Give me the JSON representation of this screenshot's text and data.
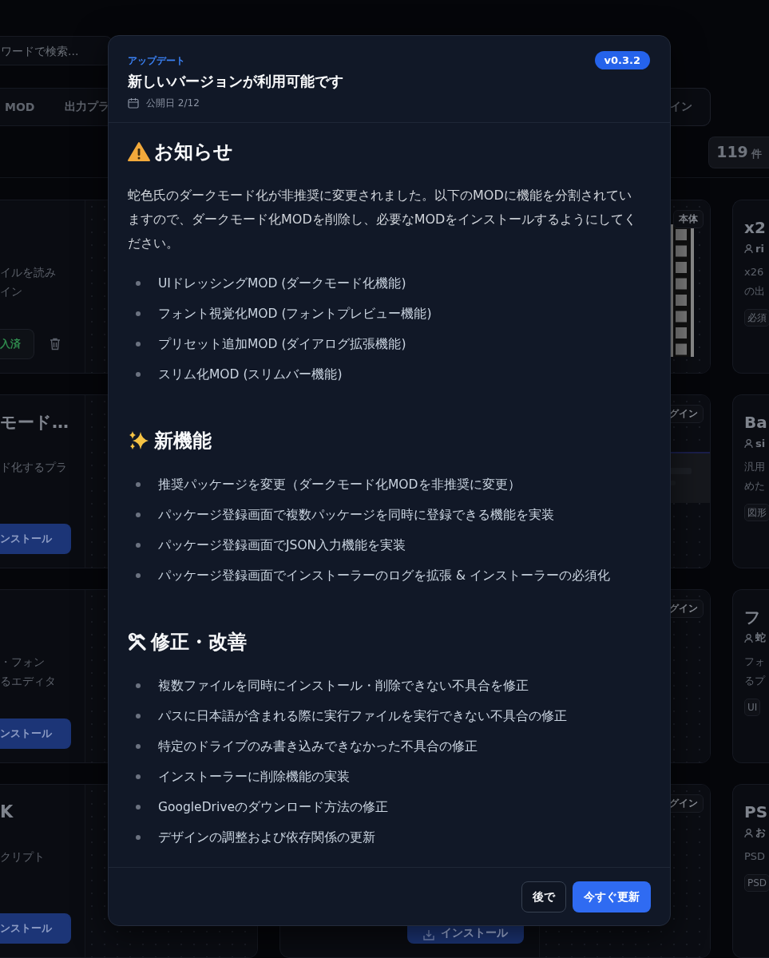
{
  "background": {
    "search": {
      "placeholder": "ワードで検索..."
    },
    "tabs": [
      {
        "label": "MOD",
        "selected": false
      },
      {
        "label": "出力プラ",
        "selected": false
      },
      {
        "label": "イン",
        "selected": false
      }
    ],
    "count": {
      "value": "119",
      "unit": "件"
    },
    "left_cards": [
      {
        "description_lines": [
          "イルを読み",
          "イン"
        ],
        "button": {
          "label": "入済",
          "kind": "installed"
        }
      },
      {
        "title": "モード…",
        "description_lines": [
          "ド化するプラ"
        ],
        "button": {
          "label": "ンストール",
          "kind": "install"
        }
      },
      {
        "description_lines": [
          "・フォン",
          "るエディタ"
        ],
        "button": {
          "label": "ンストール",
          "kind": "install"
        }
      },
      {
        "title": "K",
        "description_lines": [
          "クリプト"
        ],
        "button": {
          "label": "ンストール",
          "kind": "install"
        }
      }
    ],
    "middle_cards": [
      {
        "tag": "本体",
        "kind": "filmstrip"
      },
      {
        "tag": "グイン",
        "kind": "picture"
      },
      {
        "tag": "グイン",
        "kind": "plain"
      },
      {
        "tag": "グイン",
        "kind": "plain",
        "button": {
          "label": "インストール"
        }
      }
    ],
    "right_cards": [
      {
        "title": "x2",
        "author": "ri",
        "description_lines": [
          "x26",
          "の出"
        ],
        "tags": [
          "必須"
        ]
      },
      {
        "title": "Ba",
        "author": "si",
        "description_lines": [
          "汎用",
          "めた"
        ],
        "tags": [
          "図形"
        ]
      },
      {
        "title": "フ",
        "author": "蛇",
        "description_lines": [
          "フォ",
          "るプ"
        ],
        "tags": [
          "UI"
        ]
      },
      {
        "title": "PS",
        "author": "お",
        "description_lines": [
          "PSD"
        ],
        "tags": [
          "PSD"
        ]
      }
    ]
  },
  "dialog": {
    "eyebrow": "アップデート",
    "title": "新しいバージョンが利用可能です",
    "date": "公開日 2/12",
    "version": "v0.3.2",
    "sections": [
      {
        "kind": "warning",
        "heading": "お知らせ",
        "paragraph": "蛇色氏のダークモード化が非推奨に変更されました。以下のMODに機能を分割されていますので、ダークモード化MODを削除し、必要なMODをインストールするようにしてください。",
        "items": [
          "UIドレッシングMOD (ダークモード化機能)",
          "フォント視覚化MOD (フォントプレビュー機能)",
          "プリセット追加MOD (ダイアログ拡張機能)",
          "スリム化MOD (スリムバー機能)"
        ]
      },
      {
        "kind": "sparkles",
        "heading": "新機能",
        "items": [
          "推奨パッケージを変更（ダークモード化MODを非推奨に変更）",
          "パッケージ登録画面で複数パッケージを同時に登録できる機能を実装",
          "パッケージ登録画面でJSON入力機能を実装",
          "パッケージ登録画面でインストーラーのログを拡張 & インストーラーの必須化"
        ]
      },
      {
        "kind": "tools",
        "heading": "修正・改善",
        "items": [
          "複数ファイルを同時にインストール・削除できない不具合を修正",
          "パスに日本語が含まれる際に実行ファイルを実行できない不具合の修正",
          "特定のドライブのみ書き込みできなかった不具合の修正",
          "インストーラーに削除機能の実装",
          "GoogleDriveのダウンロード方法の修正",
          "デザインの調整および依存関係の更新"
        ]
      }
    ],
    "buttons": [
      {
        "label": "後で",
        "kind": "secondary"
      },
      {
        "label": "今すぐ更新",
        "kind": "primary"
      }
    ]
  }
}
